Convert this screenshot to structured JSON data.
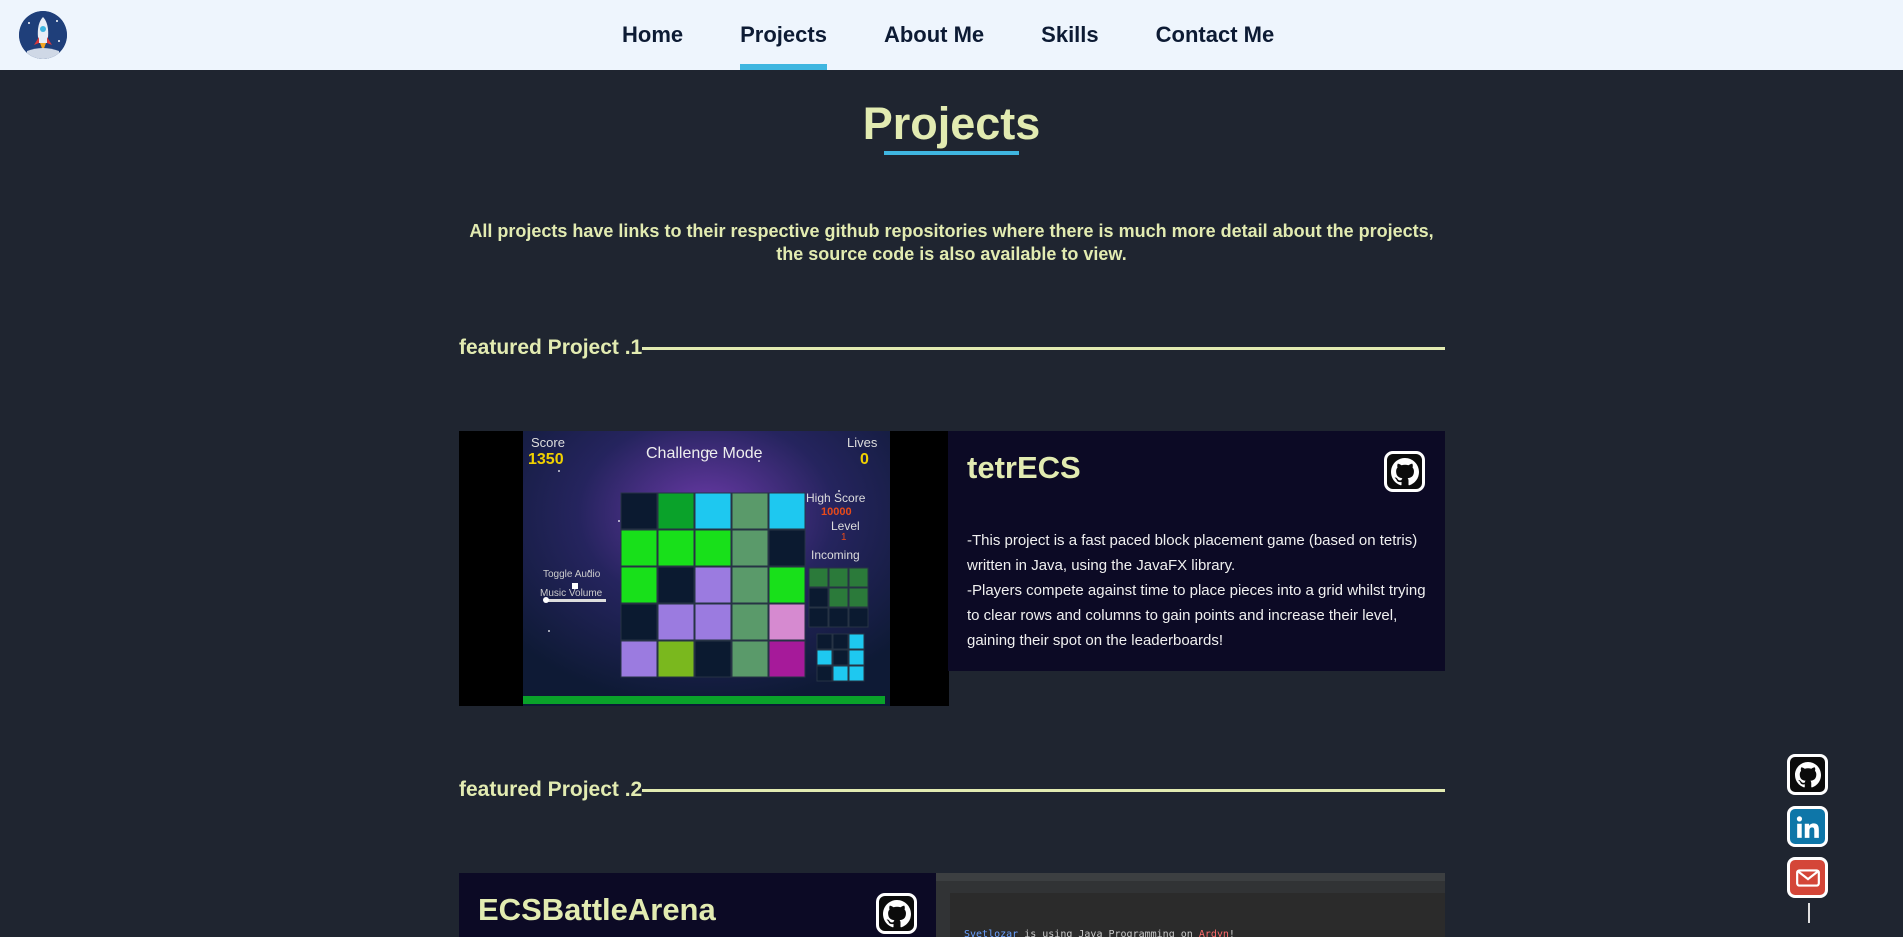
{
  "nav": {
    "items": [
      {
        "label": "Home",
        "active": false
      },
      {
        "label": "Projects",
        "active": true
      },
      {
        "label": "About Me",
        "active": false
      },
      {
        "label": "Skills",
        "active": false
      },
      {
        "label": "Contact Me",
        "active": false
      }
    ]
  },
  "page": {
    "title": "Projects",
    "intro": "All projects have links to their respective github repositories where there is much more detail about the projects, the source code is also available to view."
  },
  "projects": [
    {
      "section_label": "featured Project .1",
      "name": "tetrECS",
      "desc_1": "-This project is a fast paced block placement game (based on tetris) written in Java, using the JavaFX library.",
      "desc_2": "-Players compete against time to place pieces into a grid whilst trying to clear rows and columns to gain points and increase their level, gaining their spot on the leaderboards!",
      "screenshot": {
        "score_label": "Score",
        "score": "1350",
        "mode": "Challenge Mode",
        "lives_label": "Lives",
        "lives": "0",
        "high_score_label": "High Score",
        "high_score": "10000",
        "level_label": "Level",
        "level": "1",
        "incoming_label": "Incoming",
        "toggle_audio": "Toggle Audio",
        "music_volume": "Music Volume"
      }
    },
    {
      "section_label": "featured Project .2",
      "name": "ECSBattleArena",
      "screenshot": {
        "console_user": "Svetlozar",
        "console_text": " is using Java Programming on ",
        "console_place": "Ardyn",
        "console_end": "!"
      }
    }
  ],
  "colors": {
    "accent": "#3fb6e0",
    "heading": "#e2ebb1",
    "background": "#1f2530",
    "nav_bg": "#eef5fd",
    "card_bg": "#0c0a25",
    "linkedin": "#0e76a8",
    "email": "#d44638"
  },
  "icons": [
    "rocket-icon",
    "github-icon",
    "linkedin-icon",
    "email-icon"
  ]
}
